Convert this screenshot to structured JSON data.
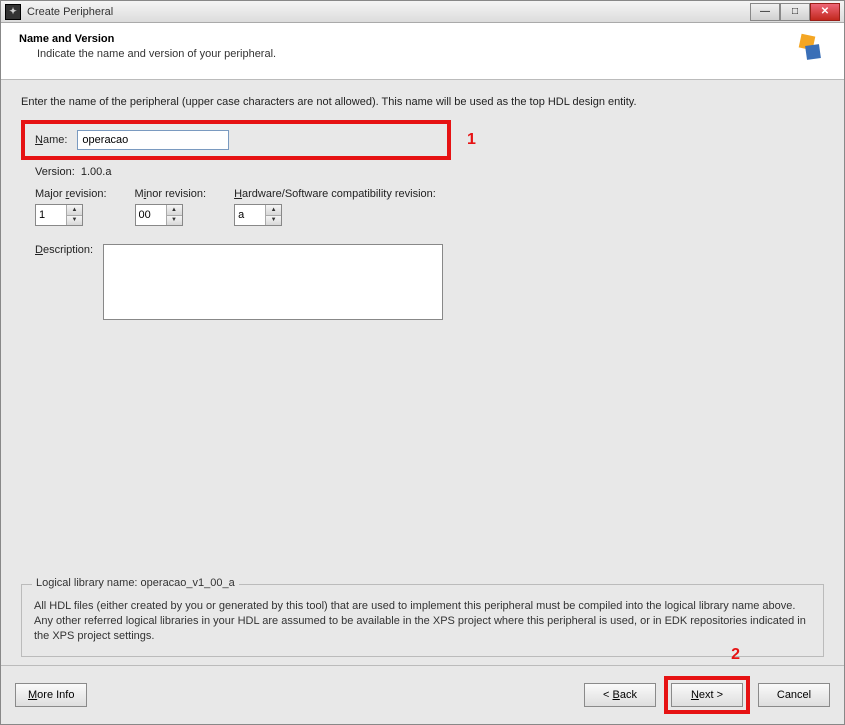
{
  "window": {
    "title": "Create Peripheral"
  },
  "header": {
    "title": "Name and Version",
    "subtitle": "Indicate the name and version of your peripheral."
  },
  "instruction": "Enter the name of the peripheral (upper case characters are not allowed). This name will be used as the top HDL design entity.",
  "name": {
    "label_pre": "N",
    "label_post": "ame:",
    "value": "operacao"
  },
  "version": {
    "label": "Version:",
    "value": "1.00.a"
  },
  "revisions": {
    "major": {
      "label_pre": "Major ",
      "label_u": "r",
      "label_post": "evision:",
      "value": "1"
    },
    "minor": {
      "label_pre": "M",
      "label_u": "i",
      "label_post": "nor revision:",
      "value": "00"
    },
    "compat": {
      "label_u": "H",
      "label_post": "ardware/Software compatibility revision:",
      "value": "a"
    }
  },
  "description": {
    "label_u": "D",
    "label_post": "escription:",
    "value": ""
  },
  "library": {
    "legend": "Logical library name: operacao_v1_00_a",
    "body": "All HDL files (either created by you or generated by this tool) that are used to implement this peripheral must be compiled into the logical library name above. Any other referred logical libraries in your HDL are assumed to be available in the XPS project where this peripheral is used, or in EDK repositories indicated in the XPS project settings."
  },
  "annotations": {
    "one": "1",
    "two": "2"
  },
  "footer": {
    "more_info_u": "M",
    "more_info_post": "ore Info",
    "back_pre": "< ",
    "back_u": "B",
    "back_post": "ack",
    "next_u": "N",
    "next_post": "ext >",
    "cancel": "Cancel"
  }
}
